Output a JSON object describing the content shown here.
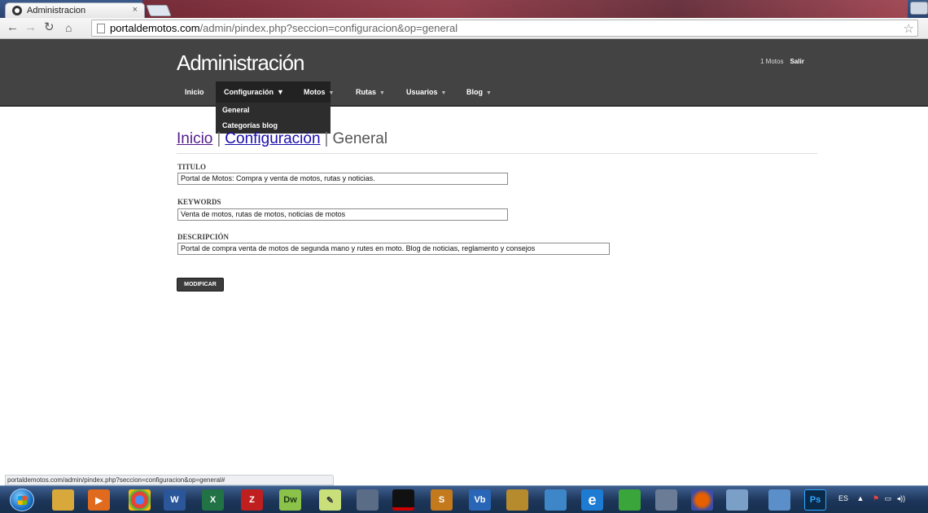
{
  "browser": {
    "tab_title": "Administracion",
    "tab_close": "×",
    "url_host": "portaldemotos.com",
    "url_path": "/admin/pindex.php?seccion=configuracion&op=general",
    "status_url": "portaldemotos.com/admin/pindex.php?seccion=configuracion&op=general#"
  },
  "header": {
    "logo": "Administración",
    "user_count": "1 Motos",
    "logout": "Salir"
  },
  "nav": {
    "items": [
      {
        "label": "Inicio",
        "caret": ""
      },
      {
        "label": "Configuración",
        "caret": "▼"
      },
      {
        "label": "Motos",
        "caret": "▼"
      },
      {
        "label": "Rutas",
        "caret": "▼"
      },
      {
        "label": "Usuarios",
        "caret": "▼"
      },
      {
        "label": "Blog",
        "caret": "▼"
      }
    ],
    "active": "Configuración",
    "dropdown": [
      "General",
      "Categorías blog"
    ]
  },
  "breadcrumb": {
    "home": "Inicio",
    "section": "Configuración",
    "current": "General",
    "separator": "|"
  },
  "form": {
    "titulo_label": "TITULO",
    "titulo_value": "Portal de Motos: Compra y venta de motos, rutas y noticias.",
    "keywords_label": "KEYWORDS",
    "keywords_value": "Venta de motos, rutas de motos, noticias de motos",
    "descripcion_label": "DESCRIPCIÓN",
    "descripcion_value": "Portal de compra venta de motos de segunda mano y rutes en moto. Blog de noticias, reglamento y consejos",
    "submit_label": "MODIFICAR"
  },
  "taskbar": {
    "apps": [
      "windows-explorer",
      "media-player",
      "chrome",
      "word",
      "excel",
      "filezilla",
      "dreamweaver",
      "notepad",
      "inkscape",
      "terminal",
      "sublime",
      "virtualbox",
      "brush",
      "network",
      "internet-explorer",
      "utorrent",
      "image-viewer",
      "firefox",
      "paint",
      "window-switcher",
      "photoshop"
    ],
    "app_labels": {
      "word": "W",
      "excel": "X",
      "filezilla": "Z",
      "dreamweaver": "Dw",
      "sublime": "S",
      "virtualbox": "Vb",
      "internet-explorer": "e",
      "photoshop": "Ps"
    },
    "language": "ES",
    "colors": {
      "header_bg": "#434343",
      "nav_active": "#222222",
      "taskbar": "#1c3559",
      "link": "#1a0dab"
    }
  }
}
